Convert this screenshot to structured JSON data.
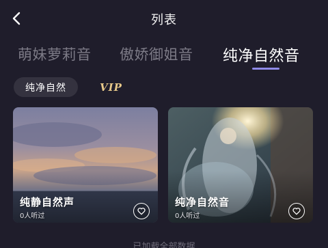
{
  "header": {
    "title": "列表",
    "back_icon": "chevron-left-icon"
  },
  "tabs": [
    {
      "label": "萌妹萝莉音",
      "active": false
    },
    {
      "label": "傲娇御姐音",
      "active": false
    },
    {
      "label": "纯净自然音",
      "active": true
    }
  ],
  "filters": {
    "chip_label": "纯净自然",
    "vip_label": "VIP"
  },
  "cards": [
    {
      "name": "纯静自然声",
      "count": "0人听过",
      "icon": "heart-icon"
    },
    {
      "name": "纯净自然音",
      "count": "0人听过",
      "icon": "heart-icon"
    }
  ],
  "footer": {
    "text": "已加载全部数据"
  },
  "colors": {
    "background": "#1f1d2b",
    "accent": "#8f8ae8",
    "vip": "#e8c98a",
    "chip_bg": "#34323f"
  }
}
